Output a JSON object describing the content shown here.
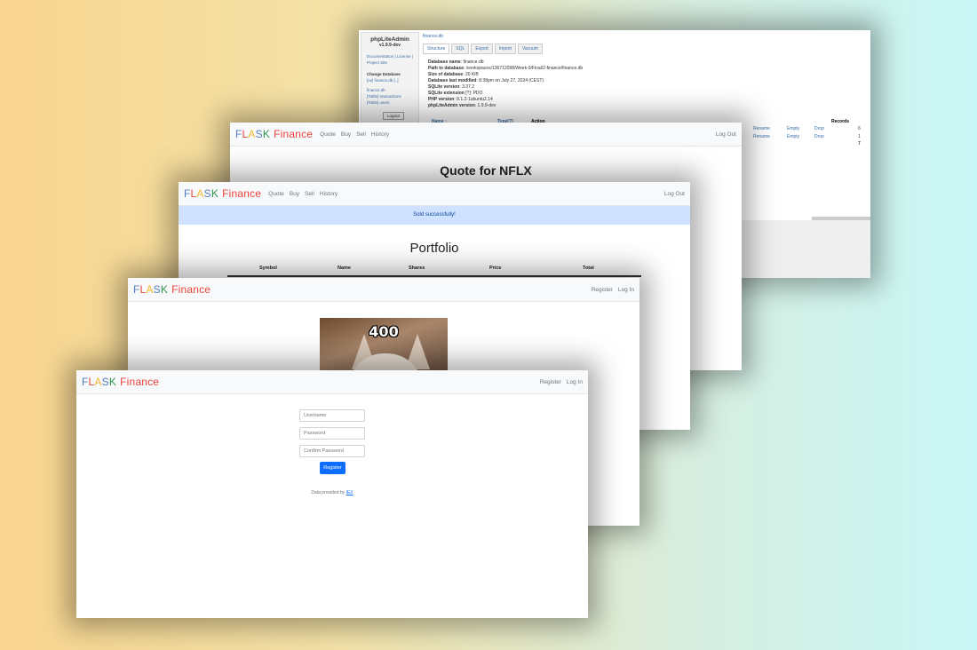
{
  "brand": {
    "letters": [
      "F",
      "L",
      "A",
      "S",
      "K"
    ],
    "word": "Finance"
  },
  "admin": {
    "app_title": "phpLiteAdmin",
    "version": "v1.9.9-dev",
    "links": "Documentation | License | Project Site",
    "change_db": "Change Database",
    "db_link": "[rw] finance.db [..]",
    "tree": [
      "finance.db",
      "[Table] transactions",
      "[Table] users"
    ],
    "logout": "Logout",
    "breadcrumb": "finance.db",
    "tabs": [
      "Structure",
      "SQL",
      "Export",
      "Import",
      "Vacuum"
    ],
    "info": [
      {
        "k": "Database name",
        "v": ": finance.db"
      },
      {
        "k": "Path to database",
        "v": ": /workspaces/136712098/Week-9/Final/2-finance/finance.db"
      },
      {
        "k": "Size of database",
        "v": ": 20 KiB"
      },
      {
        "k": "Database last modified",
        "v": ": 8:38pm on July 27, 2024 (CEST)"
      },
      {
        "k": "SQLite version",
        "v": ": 3.37.2"
      },
      {
        "k": "SQLite extension",
        "v": " [?]: PDO"
      },
      {
        "k": "PHP version",
        "v": ": 8.1.2-1ubuntu2.14"
      },
      {
        "k": "phpLiteAdmin version",
        "v": ": 1.9.9-dev"
      }
    ],
    "headers": {
      "name": "Name ↑",
      "type": "Type[?]",
      "action": "Action",
      "records": "Records"
    },
    "rows": [
      {
        "rename": "Rename",
        "empty": "Empty",
        "drop": "Drop",
        "records": "6"
      },
      {
        "rename": "Rename",
        "empty": "Empty",
        "drop": "Drop",
        "records": "1"
      }
    ],
    "total": "7"
  },
  "quote": {
    "nav": [
      "Quote",
      "Buy",
      "Sell",
      "History"
    ],
    "logout": "Log Out",
    "title": "Quote for NFLX"
  },
  "portfolio": {
    "nav": [
      "Quote",
      "Buy",
      "Sell",
      "History"
    ],
    "logout": "Log Out",
    "alert": "Sold successfully!",
    "title": "Portfolio",
    "columns": [
      "Symbol",
      "Name",
      "Shares",
      "Price",
      "Total"
    ]
  },
  "error": {
    "nav_right": [
      "Register",
      "Log In"
    ],
    "code": "400"
  },
  "register": {
    "nav_right": [
      "Register",
      "Log In"
    ],
    "username_placeholder": "Username",
    "password_placeholder": "Password",
    "confirm_placeholder": "Confirm Password",
    "button": "Register",
    "footer_text": "Data provided by ",
    "footer_link": "IEX"
  }
}
